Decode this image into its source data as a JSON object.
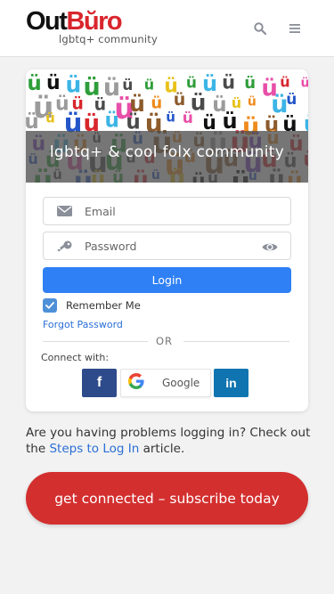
{
  "header": {
    "logo_primary": "Out",
    "logo_accent": "Bŭro",
    "logo_tagline": "lgbtq+ community",
    "icons": [
      "search-icon",
      "hamburger-menu-icon"
    ],
    "icon_color": "#8a8f99"
  },
  "card": {
    "banner_title": "lgbtq+ & cool folx community",
    "email": {
      "placeholder": "Email",
      "value": ""
    },
    "password": {
      "placeholder": "Password",
      "value": ""
    },
    "login_label": "Login",
    "remember_label": "Remember Me",
    "remember_checked": true,
    "forgot_label": "Forgot Password",
    "or_label": "OR",
    "connect_label": "Connect with:",
    "social": {
      "facebook": "f",
      "google_label": "Google",
      "linkedin": "in"
    }
  },
  "help": {
    "pre": "Are you having problems logging in? Check out the ",
    "link": "Steps to Log In",
    "post": " article."
  },
  "cta": {
    "label": "get connected – subscribe today"
  },
  "colors": {
    "accent_red": "#d32f2f",
    "login_blue": "#2f80f4",
    "link_blue": "#2a6fd6",
    "facebook": "#2d4a8b",
    "linkedin": "#1074b0"
  }
}
